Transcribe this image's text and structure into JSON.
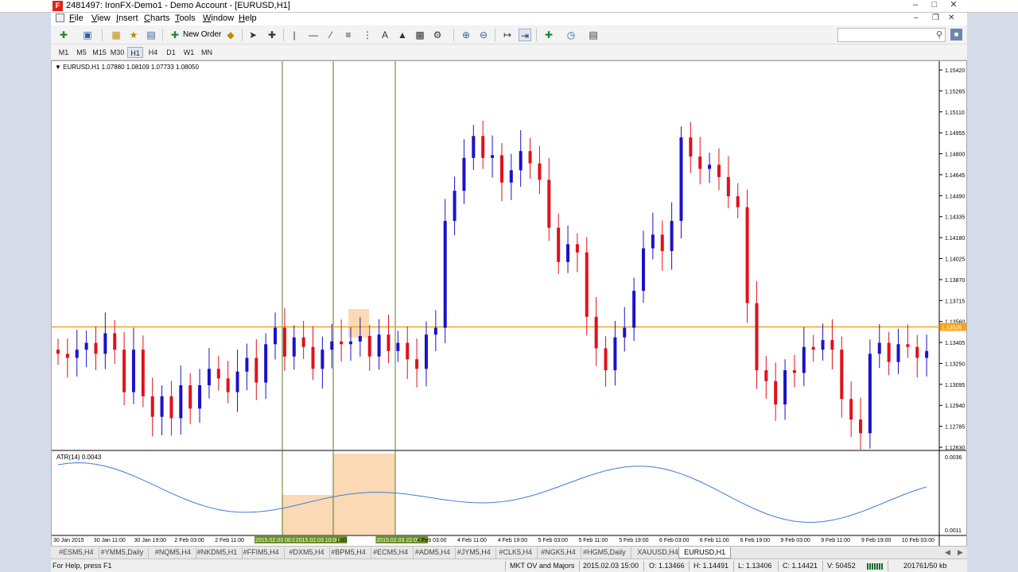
{
  "window": {
    "title": "2481497: IronFX-Demo1 - Demo Account - [EURUSD,H1]",
    "app_icon": "F"
  },
  "menu": [
    {
      "label": "File",
      "u": "F",
      "rest": "ile"
    },
    {
      "label": "View",
      "u": "V",
      "rest": "iew"
    },
    {
      "label": "Insert",
      "u": "I",
      "rest": "nsert"
    },
    {
      "label": "Charts",
      "u": "C",
      "rest": "harts"
    },
    {
      "label": "Tools",
      "u": "T",
      "rest": "ools"
    },
    {
      "label": "Window",
      "u": "W",
      "rest": "indow"
    },
    {
      "label": "Help",
      "u": "H",
      "rest": "elp"
    }
  ],
  "toolbar": {
    "new_order": "New Order"
  },
  "timeframes": [
    "M1",
    "M5",
    "M15",
    "M30",
    "H1",
    "H4",
    "D1",
    "W1",
    "MN"
  ],
  "timeframe_active": "H1",
  "chart": {
    "header": "EURUSD,H1  1.07880 1.08109 1.07733 1.08050",
    "price_labels": [
      "1.15420",
      "1.15265",
      "1.15110",
      "1.14955",
      "1.14800",
      "1.14645",
      "1.14490",
      "1.14335",
      "1.14180",
      "1.14025",
      "1.13870",
      "1.13715",
      "1.13560",
      "1.13405",
      "1.13250",
      "1.13095",
      "1.12940",
      "1.12785",
      "1.12630"
    ],
    "current_price": "1.13526",
    "bid_line_color": "#f5a31a",
    "bull_color": "#1a12c8",
    "bear_color": "#e0111b",
    "indicator": {
      "label": "ATR(14) 0.0043",
      "max_label": "0.0036",
      "min_label": "0.0011",
      "line_color": "#3d7cd6"
    },
    "time_labels": [
      "30 Jan 2015",
      "30 Jan 11:00",
      "30 Jan 19:00",
      "2 Feb 03:00",
      "2 Feb 11:00",
      "2015.02.03 00:00",
      "2015.02.03 10:00",
      "1:00",
      "2015.02.03 22:00",
      "4 Feb 03:00",
      "4 Feb 11:00",
      "4 Feb 19:00",
      "5 Feb 03:00",
      "5 Feb 11:00",
      "5 Feb 19:00",
      "6 Feb 03:00",
      "6 Feb 11:00",
      "6 Feb 19:00",
      "9 Feb 03:00",
      "9 Feb 11:00",
      "9 Feb 19:00",
      "10 Feb 03:00"
    ]
  },
  "chart_data": {
    "type": "candlestick",
    "symbol": "EURUSD",
    "timeframe": "H1",
    "ylim": [
      1.1263,
      1.1542
    ],
    "current_price": 1.13526,
    "closes": [
      1.1333,
      1.133,
      1.1336,
      1.1341,
      1.1333,
      1.1348,
      1.1336,
      1.1305,
      1.1336,
      1.1302,
      1.1287,
      1.1302,
      1.1286,
      1.131,
      1.1293,
      1.131,
      1.1322,
      1.1315,
      1.1305,
      1.132,
      1.133,
      1.1312,
      1.134,
      1.1352,
      1.1331,
      1.1345,
      1.1338,
      1.1322,
      1.1336,
      1.1342,
      1.134,
      1.1342,
      1.1346,
      1.1331,
      1.1347,
      1.1335,
      1.1341,
      1.1329,
      1.1322,
      1.1347,
      1.1352,
      1.143,
      1.1452,
      1.1476,
      1.1492,
      1.1476,
      1.1478,
      1.1458,
      1.1467,
      1.1481,
      1.1472,
      1.146,
      1.1425,
      1.14,
      1.1413,
      1.1407,
      1.136,
      1.1337,
      1.1321,
      1.1345,
      1.1352,
      1.1379,
      1.141,
      1.142,
      1.1408,
      1.143,
      1.1491,
      1.1477,
      1.1468,
      1.1471,
      1.1462,
      1.1448,
      1.144,
      1.137,
      1.1321,
      1.1313,
      1.1296,
      1.1321,
      1.1319,
      1.1338,
      1.1336,
      1.1343,
      1.1336,
      1.13,
      1.1285,
      1.1275,
      1.1333,
      1.1341,
      1.1327,
      1.134,
      1.1338,
      1.133,
      1.1335
    ],
    "atr": {
      "name": "ATR(14)",
      "last_value": 0.0043,
      "ylim": [
        0.0011,
        0.0036
      ]
    }
  }
}
